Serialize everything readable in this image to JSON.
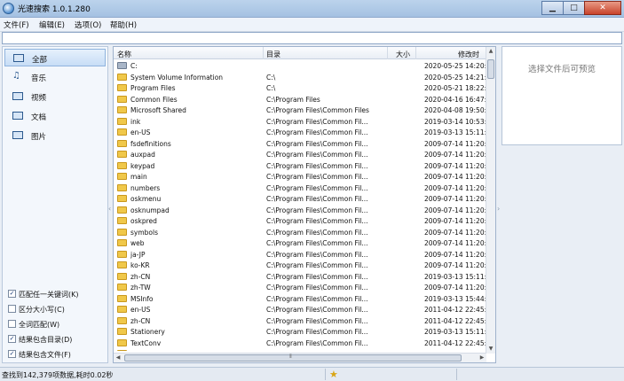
{
  "window": {
    "title": "光速搜索 1.0.1.280",
    "buttons": {
      "minimize": "▁",
      "maximize": "□",
      "close": "✕"
    }
  },
  "menu": [
    "文件(F)",
    "编辑(E)",
    "选项(O)",
    "帮助(H)"
  ],
  "search": {
    "value": "",
    "placeholder": ""
  },
  "categories": [
    {
      "label": "全部",
      "icon": "all-icon",
      "active": true
    },
    {
      "label": "音乐",
      "icon": "music-icon",
      "active": false
    },
    {
      "label": "视频",
      "icon": "video-icon",
      "active": false
    },
    {
      "label": "文档",
      "icon": "document-icon",
      "active": false
    },
    {
      "label": "图片",
      "icon": "picture-icon",
      "active": false
    }
  ],
  "options": [
    {
      "label": "匹配任一关键词(K)",
      "checked": true
    },
    {
      "label": "区分大小写(C)",
      "checked": false
    },
    {
      "label": "全词匹配(W)",
      "checked": false
    },
    {
      "label": "结果包含目录(D)",
      "checked": true
    },
    {
      "label": "结果包含文件(F)",
      "checked": true
    }
  ],
  "columns": {
    "name": "名称",
    "dir": "目录",
    "size": "大小",
    "time": "修改时"
  },
  "files": [
    {
      "name": "C:",
      "dir": "",
      "time": "2020-05-25 14:20:",
      "icon": "drive-icon"
    },
    {
      "name": "System Volume Information",
      "dir": "C:\\",
      "time": "2020-05-25 14:21:",
      "icon": "folder-icon"
    },
    {
      "name": "Program Files",
      "dir": "C:\\",
      "time": "2020-05-21 18:22:",
      "icon": "folder-icon"
    },
    {
      "name": "Common Files",
      "dir": "C:\\Program Files",
      "time": "2020-04-16 16:47:",
      "icon": "folder-icon"
    },
    {
      "name": "Microsoft Shared",
      "dir": "C:\\Program Files\\Common Files",
      "time": "2020-04-08 19:50:",
      "icon": "folder-icon"
    },
    {
      "name": "ink",
      "dir": "C:\\Program Files\\Common Fil...",
      "time": "2019-03-14 10:53:",
      "icon": "folder-icon"
    },
    {
      "name": "en-US",
      "dir": "C:\\Program Files\\Common Fil...",
      "time": "2019-03-13 15:11:",
      "icon": "folder-icon"
    },
    {
      "name": "fsdefinitions",
      "dir": "C:\\Program Files\\Common Fil...",
      "time": "2009-07-14 11:20:",
      "icon": "folder-icon"
    },
    {
      "name": "auxpad",
      "dir": "C:\\Program Files\\Common Fil...",
      "time": "2009-07-14 11:20:",
      "icon": "folder-icon"
    },
    {
      "name": "keypad",
      "dir": "C:\\Program Files\\Common Fil...",
      "time": "2009-07-14 11:20:",
      "icon": "folder-icon"
    },
    {
      "name": "main",
      "dir": "C:\\Program Files\\Common Fil...",
      "time": "2009-07-14 11:20:",
      "icon": "folder-icon"
    },
    {
      "name": "numbers",
      "dir": "C:\\Program Files\\Common Fil...",
      "time": "2009-07-14 11:20:",
      "icon": "folder-icon"
    },
    {
      "name": "oskmenu",
      "dir": "C:\\Program Files\\Common Fil...",
      "time": "2009-07-14 11:20:",
      "icon": "folder-icon"
    },
    {
      "name": "osknumpad",
      "dir": "C:\\Program Files\\Common Fil...",
      "time": "2009-07-14 11:20:",
      "icon": "folder-icon"
    },
    {
      "name": "oskpred",
      "dir": "C:\\Program Files\\Common Fil...",
      "time": "2009-07-14 11:20:",
      "icon": "folder-icon"
    },
    {
      "name": "symbols",
      "dir": "C:\\Program Files\\Common Fil...",
      "time": "2009-07-14 11:20:",
      "icon": "folder-icon"
    },
    {
      "name": "web",
      "dir": "C:\\Program Files\\Common Fil...",
      "time": "2009-07-14 11:20:",
      "icon": "folder-icon"
    },
    {
      "name": "ja-JP",
      "dir": "C:\\Program Files\\Common Fil...",
      "time": "2009-07-14 11:20:",
      "icon": "folder-icon"
    },
    {
      "name": "ko-KR",
      "dir": "C:\\Program Files\\Common Fil...",
      "time": "2009-07-14 11:20:",
      "icon": "folder-icon"
    },
    {
      "name": "zh-CN",
      "dir": "C:\\Program Files\\Common Fil...",
      "time": "2019-03-13 15:11:",
      "icon": "folder-icon"
    },
    {
      "name": "zh-TW",
      "dir": "C:\\Program Files\\Common Fil...",
      "time": "2009-07-14 11:20:",
      "icon": "folder-icon"
    },
    {
      "name": "MSInfo",
      "dir": "C:\\Program Files\\Common Fil...",
      "time": "2019-03-13 15:44:",
      "icon": "folder-icon"
    },
    {
      "name": "en-US",
      "dir": "C:\\Program Files\\Common Fil...",
      "time": "2011-04-12 22:45:",
      "icon": "folder-icon"
    },
    {
      "name": "zh-CN",
      "dir": "C:\\Program Files\\Common Fil...",
      "time": "2011-04-12 22:45:",
      "icon": "folder-icon"
    },
    {
      "name": "Stationery",
      "dir": "C:\\Program Files\\Common Fil...",
      "time": "2019-03-13 15:11:",
      "icon": "folder-icon"
    },
    {
      "name": "TextConv",
      "dir": "C:\\Program Files\\Common Fil...",
      "time": "2011-04-12 22:45:",
      "icon": "folder-icon"
    },
    {
      "name": "en-US",
      "dir": "C:\\Program Files\\Common Fil...",
      "time": "2011-04-12 22:45:",
      "icon": "folder-icon"
    }
  ],
  "preview": {
    "placeholder": "选择文件后可预览"
  },
  "status": {
    "text": "查找到142,379项数据,耗时0.02秒"
  },
  "colors": {
    "titlebar": "#a4c1e2",
    "folder": "#f0c84a",
    "selection": "#c7ddf6"
  }
}
